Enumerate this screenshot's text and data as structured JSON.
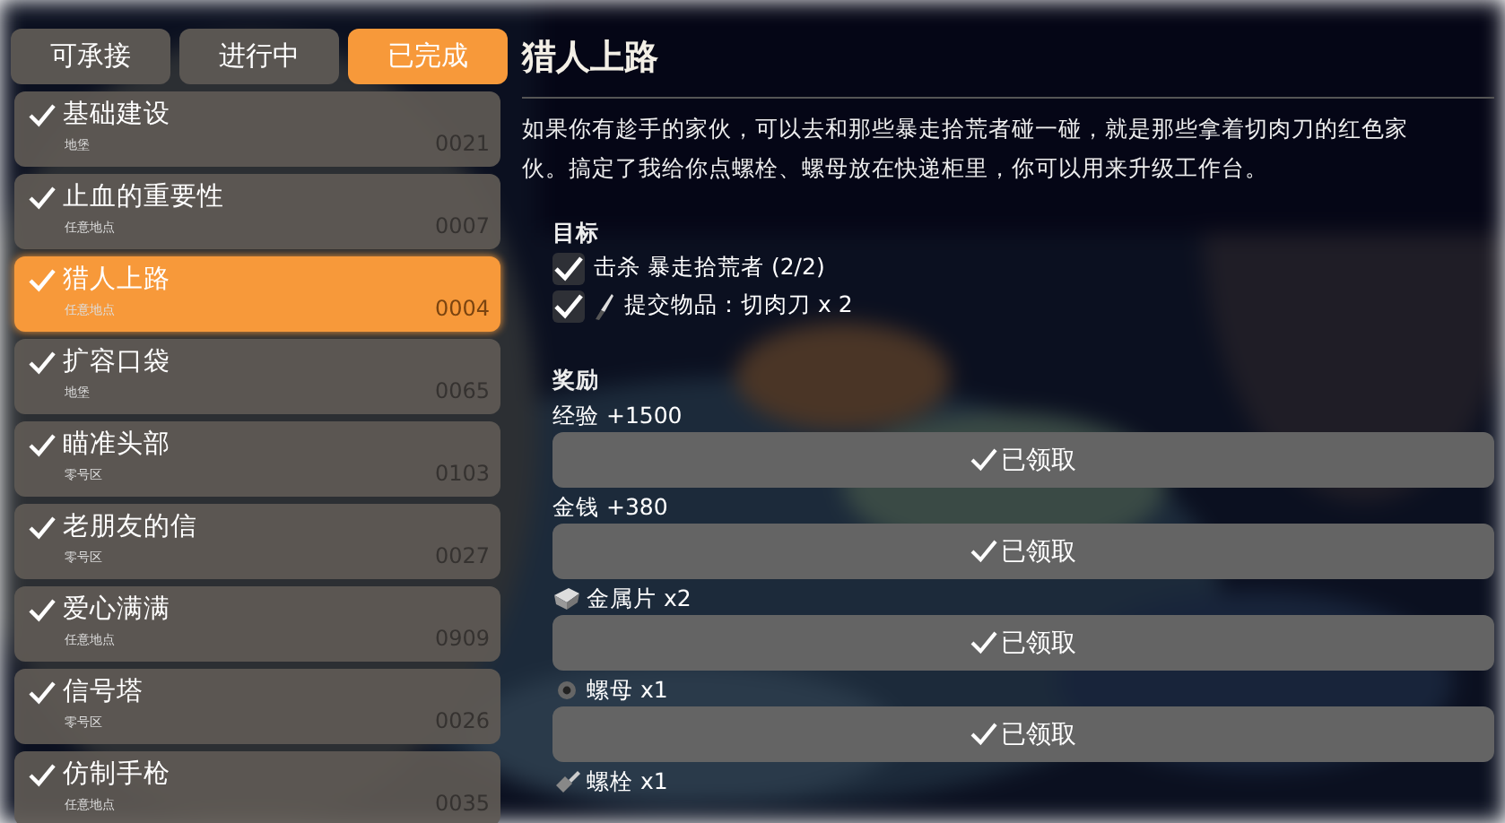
{
  "tabs": [
    {
      "label": "可承接",
      "selected": false
    },
    {
      "label": "进行中",
      "selected": false
    },
    {
      "label": "已完成",
      "selected": true
    }
  ],
  "quests": [
    {
      "title": "基础建设",
      "location": "地堡",
      "number": "0021",
      "completed": true,
      "selected": false
    },
    {
      "title": "止血的重要性",
      "location": "任意地点",
      "number": "0007",
      "completed": true,
      "selected": false
    },
    {
      "title": "猎人上路",
      "location": "任意地点",
      "number": "0004",
      "completed": true,
      "selected": true
    },
    {
      "title": "扩容口袋",
      "location": "地堡",
      "number": "0065",
      "completed": true,
      "selected": false
    },
    {
      "title": "瞄准头部",
      "location": "零号区",
      "number": "0103",
      "completed": true,
      "selected": false
    },
    {
      "title": "老朋友的信",
      "location": "零号区",
      "number": "0027",
      "completed": true,
      "selected": false
    },
    {
      "title": "爱心满满",
      "location": "任意地点",
      "number": "0909",
      "completed": true,
      "selected": false
    },
    {
      "title": "信号塔",
      "location": "零号区",
      "number": "0026",
      "completed": true,
      "selected": false
    },
    {
      "title": "仿制手枪",
      "location": "任意地点",
      "number": "0035",
      "completed": true,
      "selected": false
    }
  ],
  "detail": {
    "title": "猎人上路",
    "description": "如果你有趁手的家伙，可以去和那些暴走拾荒者碰一碰，就是那些拿着切肉刀的红色家伙。搞定了我给你点螺栓、螺母放在快递柜里，你可以用来升级工作台。",
    "objectives_heading": "目标",
    "objectives": [
      {
        "text": "击杀 暴走拾荒者 (2/2)",
        "checked": true,
        "kind": "kill"
      },
      {
        "text": "提交物品：切肉刀 x 2",
        "checked": true,
        "kind": "item"
      }
    ],
    "rewards_heading": "奖励",
    "rewards": [
      {
        "label": "经验 +1500",
        "kind": "stat",
        "button": "已领取",
        "claimed": true
      },
      {
        "label": "金钱 +380",
        "kind": "stat",
        "button": "已领取",
        "claimed": true
      },
      {
        "label": "金属片 x2",
        "kind": "sheet",
        "button": "已领取",
        "claimed": true
      },
      {
        "label": "螺母 x1",
        "kind": "nut",
        "button": "已领取",
        "claimed": true
      },
      {
        "label": "螺栓 x1",
        "kind": "bolt"
      }
    ]
  }
}
